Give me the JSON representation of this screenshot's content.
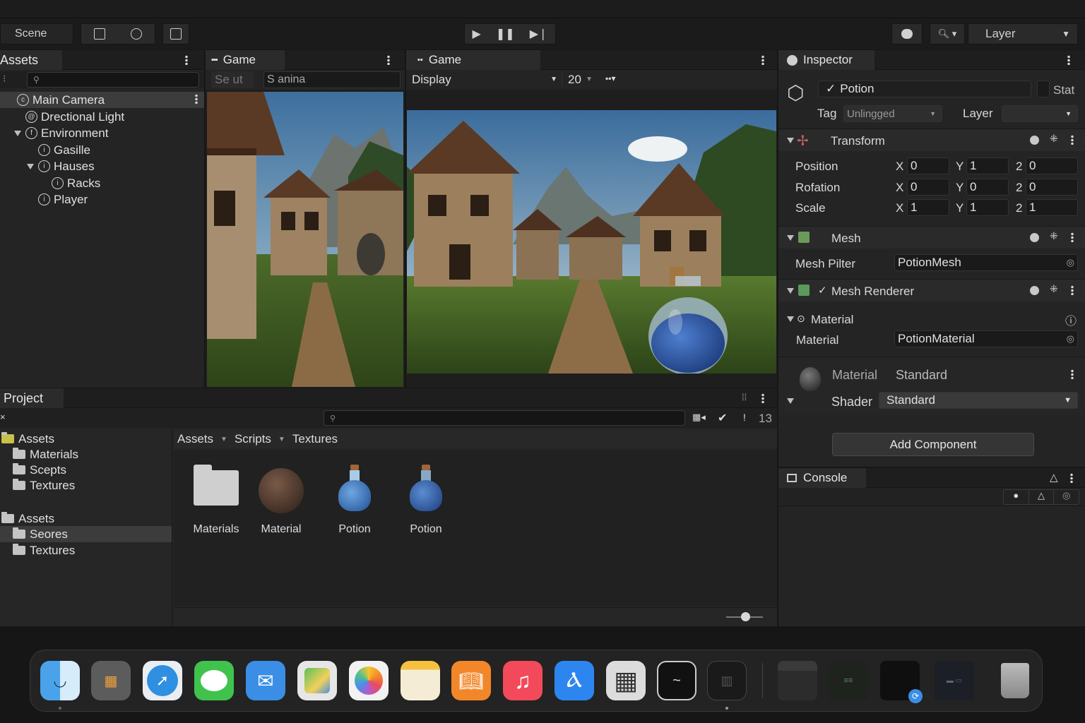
{
  "toolbar": {
    "scene_label": "Scene",
    "layer_dropdown": "Layer"
  },
  "hierarchy": {
    "title": "Assets",
    "items": [
      {
        "label": "Main Camera",
        "selected": true
      },
      {
        "label": "Drectional Light"
      },
      {
        "label": "Environment",
        "expanded": true
      },
      {
        "label": "Gasille"
      },
      {
        "label": "Hauses",
        "expanded": true
      },
      {
        "label": "Racks"
      },
      {
        "label": "Player"
      }
    ]
  },
  "game_small": {
    "title": "Game",
    "field1": "Se ut",
    "field2": "S anina"
  },
  "game_main": {
    "title": "Game",
    "display": "Display",
    "scale": "20"
  },
  "inspector": {
    "title": "Inspector",
    "object_name": "Potion",
    "static_label": "Stat",
    "tag_label": "Tag",
    "tag_value": "Unlingged",
    "layer_label": "Layer",
    "transform": {
      "title": "Transform",
      "rows": [
        {
          "label": "Position",
          "x": "0",
          "y": "1",
          "z": "0"
        },
        {
          "label": "Rofation",
          "x": "0",
          "y": "0",
          "z": "0"
        },
        {
          "label": "Scale",
          "x": "1",
          "y": "1",
          "z": "1"
        }
      ],
      "axis_x": "X",
      "axis_y": "Y",
      "axis_z": "2"
    },
    "mesh": {
      "title": "Mesh",
      "filter_label": "Mesh Pilter",
      "filter_value": "PotionMesh"
    },
    "mesh_renderer": {
      "title": "Mesh Renderer",
      "material_group": "Material",
      "material_label": "Material",
      "material_value": "PotionMaterial"
    },
    "material_section": {
      "label": "Material",
      "value": "Standard",
      "shader_label": "Shader",
      "shader_value": "Standard"
    },
    "add_component": "Add Component"
  },
  "console": {
    "title": "Console"
  },
  "project": {
    "title": "Project",
    "count": "13",
    "tree": [
      {
        "label": "Assets",
        "level": 0
      },
      {
        "label": "Materials",
        "level": 1
      },
      {
        "label": "Scepts",
        "level": 1
      },
      {
        "label": "Textures",
        "level": 1
      },
      {
        "label": "Assets",
        "level": 0
      },
      {
        "label": "Seores",
        "level": 1,
        "selected": true
      },
      {
        "label": "Textures",
        "level": 1
      }
    ],
    "breadcrumb": [
      "Assets",
      "Scripts",
      "Textures"
    ],
    "assets": [
      {
        "label": "Materials",
        "icon": "folder-icon"
      },
      {
        "label": "Material",
        "icon": "sphere-icon"
      },
      {
        "label": "Potion",
        "icon": "potion-icon"
      },
      {
        "label": "Potion",
        "icon": "potion-icon"
      }
    ]
  },
  "dock": {
    "apps": [
      "finder-icon",
      "launchpad-icon",
      "safari-icon",
      "messages-icon",
      "mail-icon",
      "maps-icon",
      "photos-icon",
      "notes-icon",
      "books-icon",
      "music-icon",
      "app-store-icon",
      "calculator-icon",
      "terminal-icon",
      "editor-icon"
    ],
    "recent": [
      "window-thumb-icon",
      "terminal-thumb-icon",
      "finder-thumb-icon",
      "screen-thumb-icon"
    ]
  }
}
